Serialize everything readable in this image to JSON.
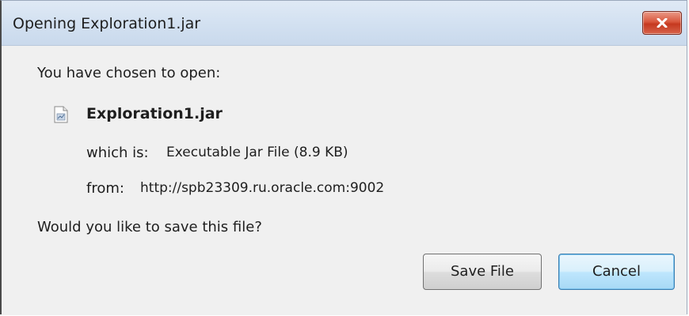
{
  "dialog": {
    "title": "Opening Exploration1.jar",
    "close_icon": "close-icon"
  },
  "content": {
    "intro": "You have chosen to open:",
    "file_icon": "jar-file-icon",
    "filename": "Exploration1.jar",
    "which_label": "which is:",
    "which_value": "Executable Jar File (8.9 KB)",
    "from_label": "from:",
    "from_value": "http://spb23309.ru.oracle.com:9002",
    "question": "Would you like to save this file?"
  },
  "buttons": {
    "save_label": "Save File",
    "cancel_label": "Cancel"
  },
  "colors": {
    "close_button": "#d4503a",
    "titlebar": "#d3e1f1",
    "dialog_background": "#f0f0f0",
    "default_button_highlight": "#bee6fd"
  }
}
